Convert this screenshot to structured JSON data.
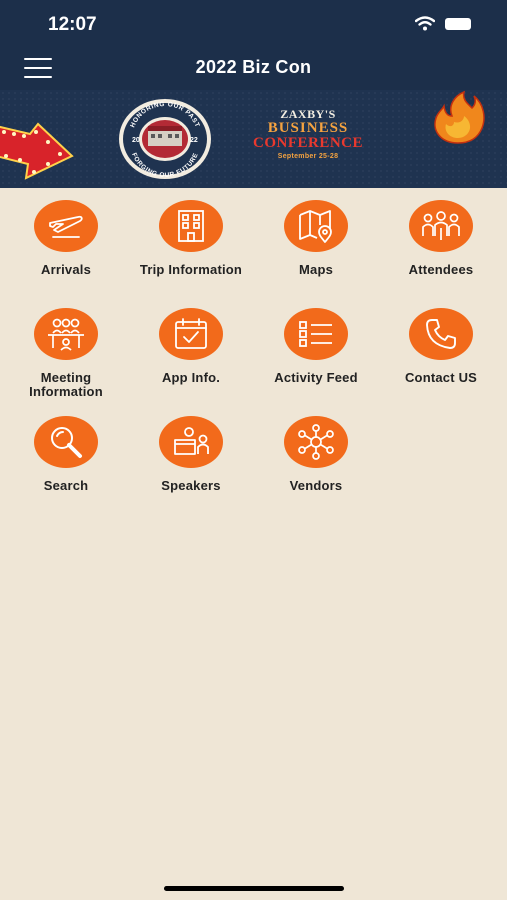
{
  "status_bar": {
    "time": "12:07"
  },
  "header": {
    "title": "2022 Biz Con"
  },
  "banner": {
    "seal": {
      "top_arc": "HONORING OUR PAST",
      "bottom_arc": "FORGING OUR FUTURE",
      "year_left": "20",
      "year_right": "22"
    },
    "brand": "ZAXBY'S",
    "line1": "BUSINESS",
    "line2": "CONFERENCE",
    "dates": "September 25-28"
  },
  "menu": {
    "items": [
      {
        "label": "Arrivals",
        "icon": "airplane-icon"
      },
      {
        "label": "Trip Information",
        "icon": "building-icon"
      },
      {
        "label": "Maps",
        "icon": "map-icon"
      },
      {
        "label": "Attendees",
        "icon": "people-icon"
      },
      {
        "label": "Meeting Information",
        "line1": "Meeting",
        "line2": "Information",
        "icon": "meeting-icon"
      },
      {
        "label": "App Info.",
        "icon": "calendar-check-icon"
      },
      {
        "label": "Activity Feed",
        "icon": "list-icon"
      },
      {
        "label": "Contact US",
        "icon": "phone-icon"
      },
      {
        "label": "Search",
        "icon": "magnifier-icon"
      },
      {
        "label": "Speakers",
        "icon": "podium-icon"
      },
      {
        "label": "Vendors",
        "icon": "network-icon"
      }
    ]
  },
  "colors": {
    "header_bg": "#1c2f4a",
    "accent": "#f26a1b",
    "page_bg": "#efe6d6",
    "text": "#222222"
  }
}
